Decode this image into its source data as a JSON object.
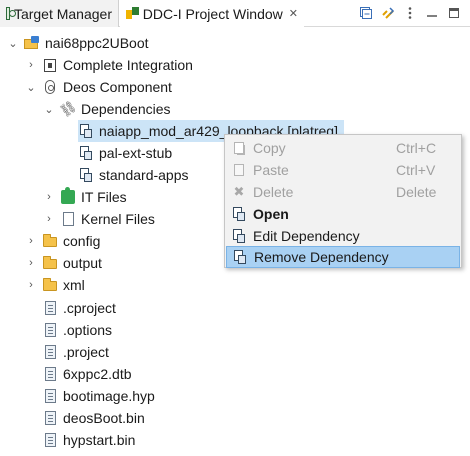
{
  "tabs": [
    {
      "label": "Target Manager",
      "icon": "target-manager-icon"
    },
    {
      "label": "DDC-I Project Window",
      "icon": "project-window-icon",
      "close": "✕"
    }
  ],
  "toolbar": [
    {
      "icon": "collapse-all-icon"
    },
    {
      "icon": "link-with-editor-icon"
    },
    {
      "icon": "view-menu-icon"
    },
    {
      "icon": "minimize-icon"
    },
    {
      "icon": "maximize-icon"
    }
  ],
  "tree": {
    "root": "nai68ppc2UBoot",
    "complete_integration": "Complete Integration",
    "deos_component": "Deos Component",
    "dependencies": "Dependencies",
    "dep_items": [
      "naiapp_mod_ar429_loopback [platreg]",
      "pal-ext-stub",
      "standard-apps"
    ],
    "it_files": "IT Files",
    "kernel_files": "Kernel Files",
    "folders": [
      "config",
      "output",
      "xml"
    ],
    "files": [
      ".cproject",
      ".options",
      ".project",
      "6xppc2.dtb",
      "bootimage.hyp",
      "deosBoot.bin",
      "hypstart.bin"
    ]
  },
  "context_menu": {
    "copy": "Copy",
    "copy_key": "Ctrl+C",
    "paste": "Paste",
    "paste_key": "Ctrl+V",
    "delete": "Delete",
    "delete_key": "Delete",
    "open": "Open",
    "edit_dependency": "Edit Dependency",
    "remove_dependency": "Remove Dependency"
  },
  "colors": {
    "selection": "#cce4f7",
    "menu_hover": "#a9d1f3",
    "folder": "#f5c24a"
  }
}
